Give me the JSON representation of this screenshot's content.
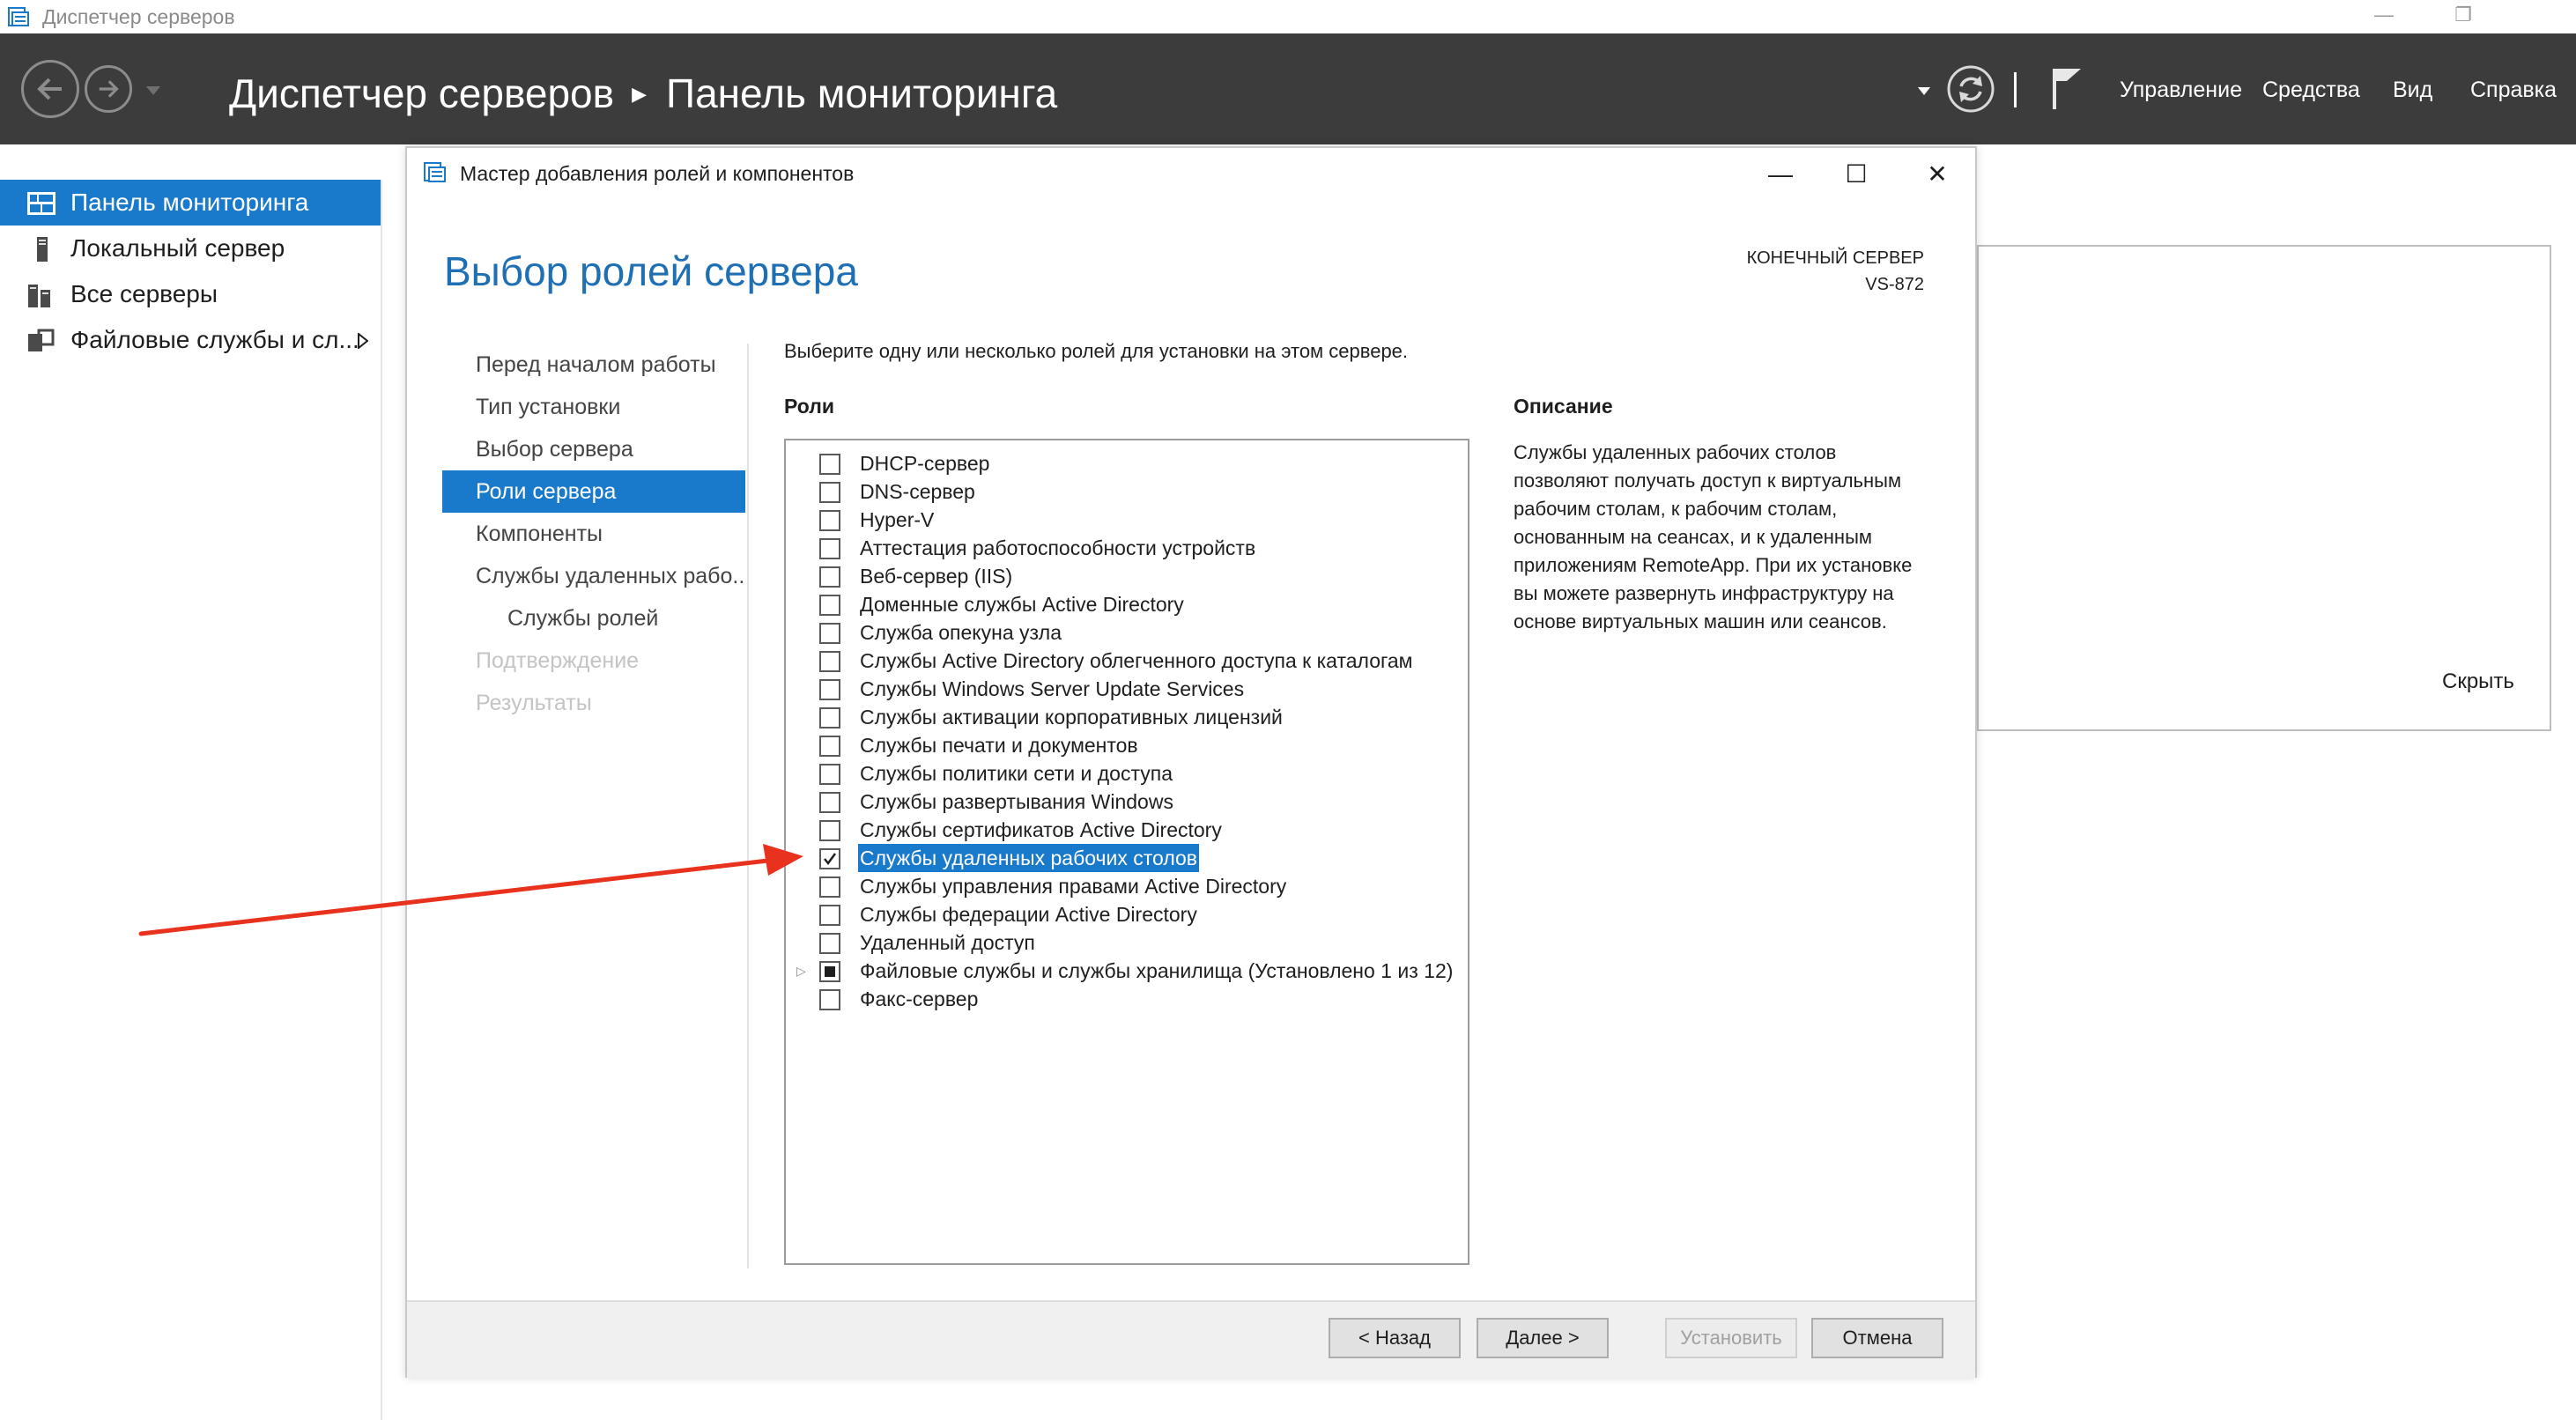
{
  "window": {
    "title": "Диспетчер серверов",
    "controls": [
      "minimize-icon",
      "restore-icon"
    ]
  },
  "header": {
    "title": "Диспетчер серверов",
    "subtitle": "Панель мониторинга",
    "menu": [
      "Управление",
      "Средства",
      "Вид",
      "Справка"
    ],
    "icons": [
      "back-icon",
      "forward-icon",
      "dropdown-icon",
      "refresh-icon",
      "flag-icon"
    ]
  },
  "sidebar": {
    "items": [
      {
        "label": "Панель мониторинга",
        "icon": "dashboard-icon",
        "active": true
      },
      {
        "label": "Локальный сервер",
        "icon": "server-icon",
        "active": false
      },
      {
        "label": "Все серверы",
        "icon": "servers-icon",
        "active": false
      },
      {
        "label": "Файловые службы и сл...",
        "icon": "file-services-icon",
        "active": false
      }
    ]
  },
  "background_panel": {
    "hide_label": "Скрыть"
  },
  "wizard": {
    "title": "Мастер добавления ролей и компонентов",
    "heading": "Выбор ролей сервера",
    "destination_label": "КОНЕЧНЫЙ СЕРВЕР",
    "destination_server": "VS-872",
    "nav": [
      {
        "label": "Перед началом работы",
        "state": "normal"
      },
      {
        "label": "Тип установки",
        "state": "normal"
      },
      {
        "label": "Выбор сервера",
        "state": "normal"
      },
      {
        "label": "Роли сервера",
        "state": "active"
      },
      {
        "label": "Компоненты",
        "state": "normal"
      },
      {
        "label": "Службы удаленных рабо...",
        "state": "normal"
      },
      {
        "label": "Службы ролей",
        "state": "sub"
      },
      {
        "label": "Подтверждение",
        "state": "disabled"
      },
      {
        "label": "Результаты",
        "state": "disabled"
      }
    ],
    "instruction": "Выберите одну или несколько ролей для установки на этом сервере.",
    "roles_label": "Роли",
    "roles": [
      {
        "label": "DHCP-сервер",
        "checked": false
      },
      {
        "label": "DNS-сервер",
        "checked": false
      },
      {
        "label": "Hyper-V",
        "checked": false
      },
      {
        "label": "Аттестация работоспособности устройств",
        "checked": false
      },
      {
        "label": "Веб-сервер (IIS)",
        "checked": false
      },
      {
        "label": "Доменные службы Active Directory",
        "checked": false
      },
      {
        "label": "Служба опекуна узла",
        "checked": false
      },
      {
        "label": "Службы Active Directory облегченного доступа к каталогам",
        "checked": false
      },
      {
        "label": "Службы Windows Server Update Services",
        "checked": false
      },
      {
        "label": "Службы активации корпоративных лицензий",
        "checked": false
      },
      {
        "label": "Службы печати и документов",
        "checked": false
      },
      {
        "label": "Службы политики сети и доступа",
        "checked": false
      },
      {
        "label": "Службы развертывания Windows",
        "checked": false
      },
      {
        "label": "Службы сертификатов Active Directory",
        "checked": false
      },
      {
        "label": "Службы удаленных рабочих столов",
        "checked": true,
        "selected": true
      },
      {
        "label": "Службы управления правами Active Directory",
        "checked": false
      },
      {
        "label": "Службы федерации Active Directory",
        "checked": false
      },
      {
        "label": "Удаленный доступ",
        "checked": false
      },
      {
        "label": "Файловые службы и службы хранилища (Установлено 1 из 12)",
        "checked": "partial",
        "expandable": true
      },
      {
        "label": "Факс-сервер",
        "checked": false
      }
    ],
    "description_label": "Описание",
    "description": "Службы удаленных рабочих столов позволяют получать доступ к виртуальным рабочим столам, к рабочим столам, основанным на сеансах, и к удаленным приложениям RemoteApp. При их установке вы можете развернуть инфраструктуру на основе виртуальных машин или сеансов.",
    "buttons": {
      "back": "< Назад",
      "next": "Далее >",
      "install": "Установить",
      "cancel": "Отмена"
    }
  },
  "colors": {
    "accent": "#1979ca",
    "header_bg": "#3c3c3c",
    "heading": "#1f6fb5",
    "annotation_arrow": "#e8321e"
  }
}
